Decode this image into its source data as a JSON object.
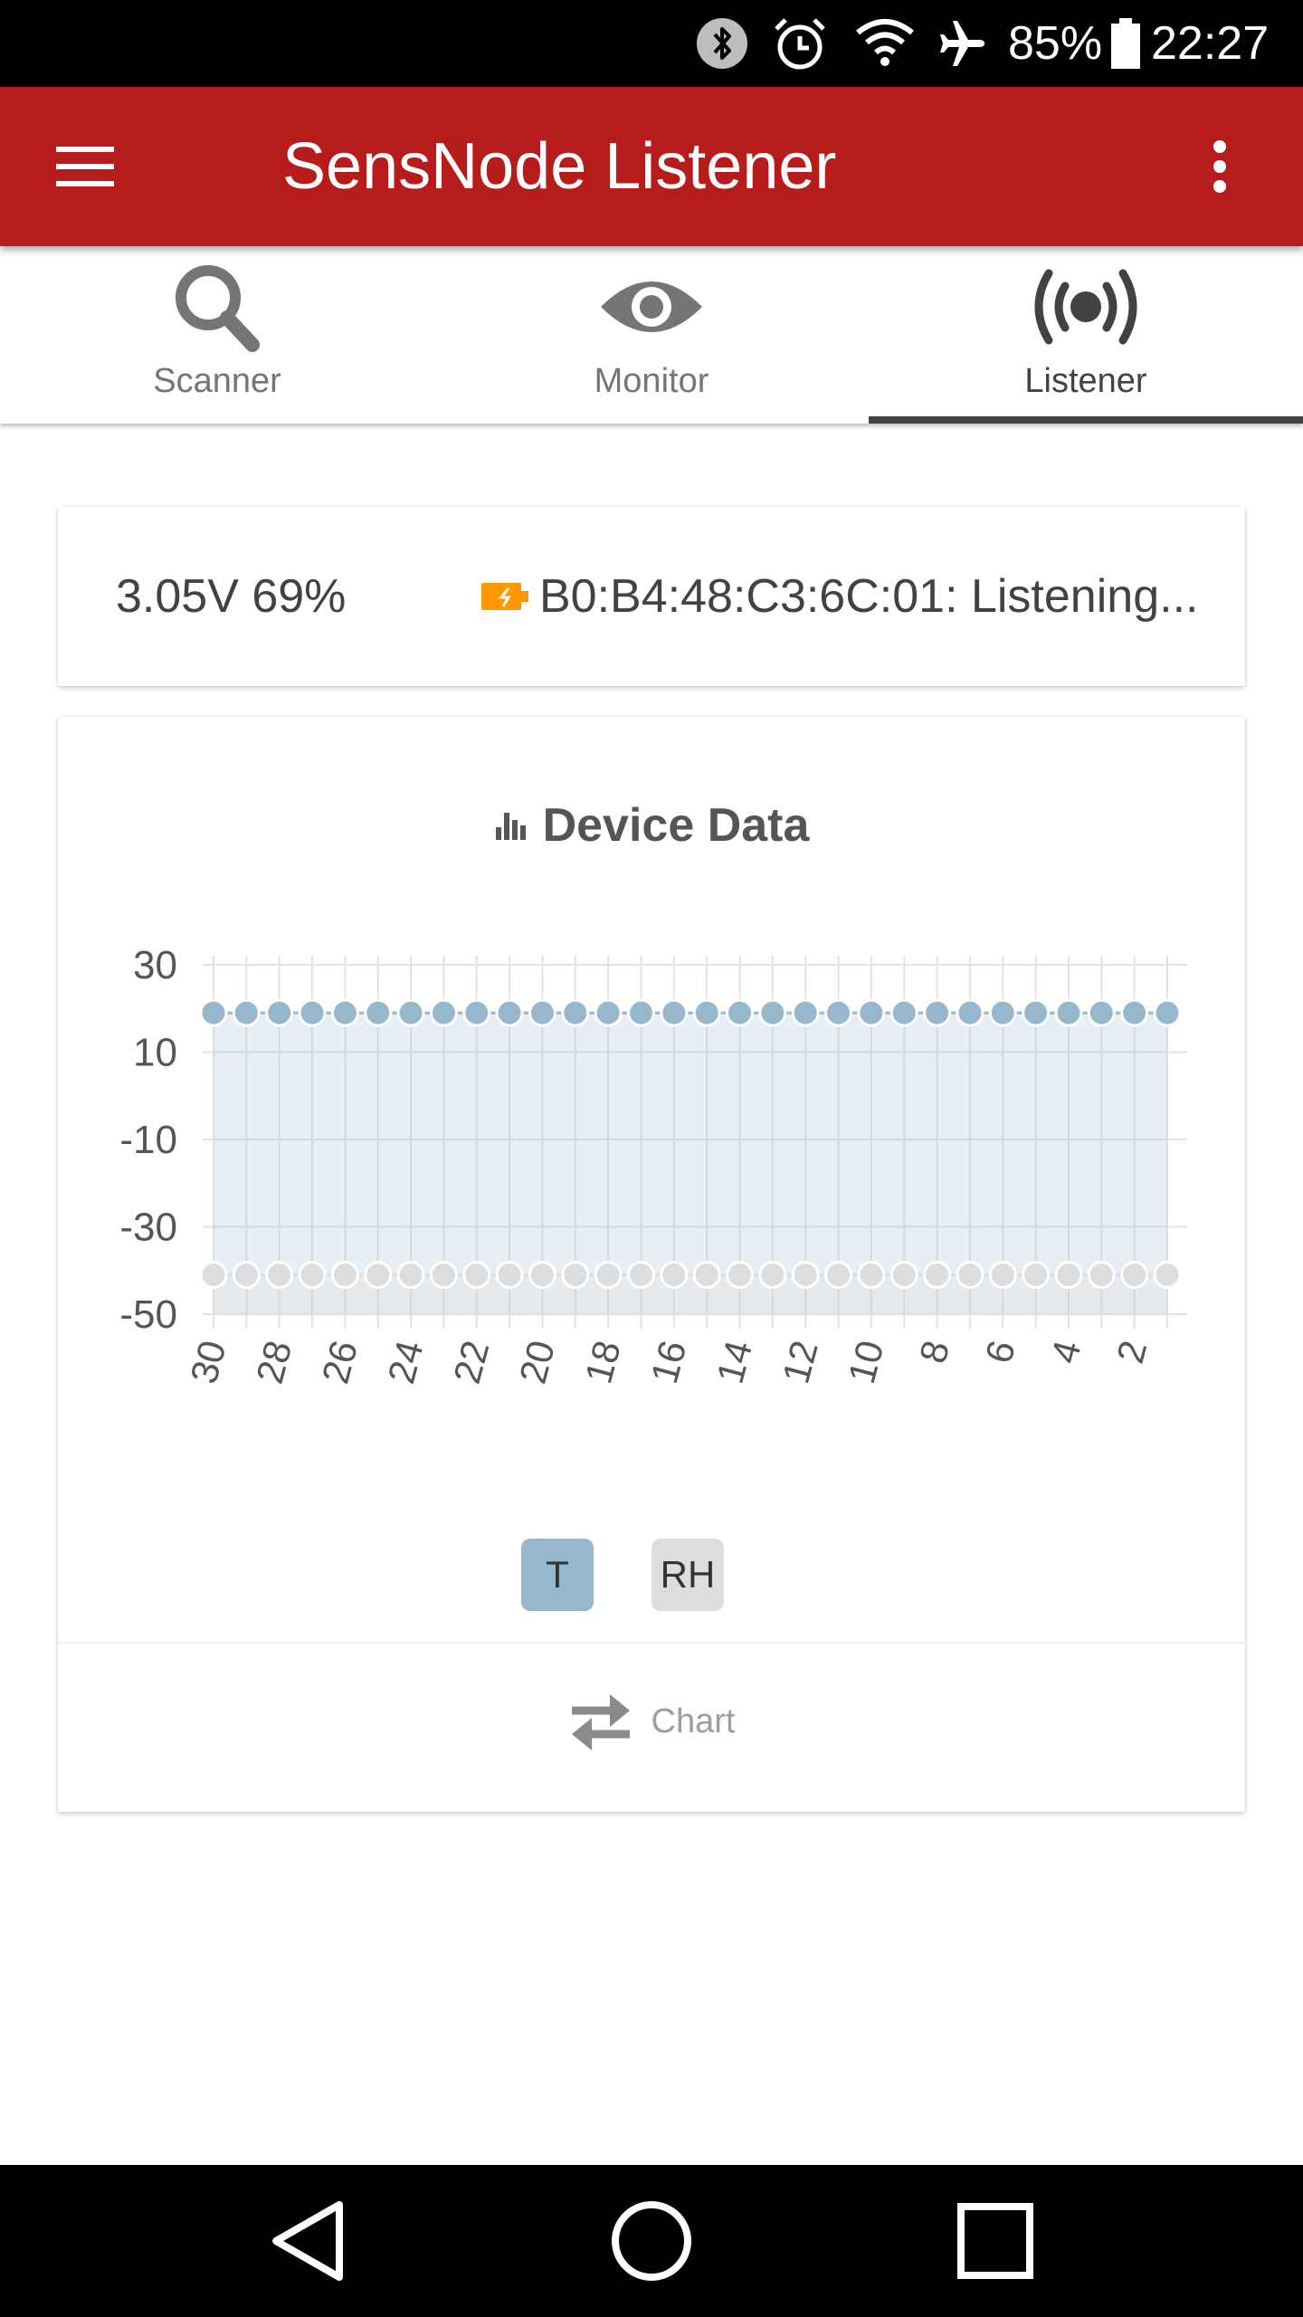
{
  "status_bar": {
    "battery_percent": "85%",
    "time": "22:27",
    "icons": [
      "bluetooth-icon",
      "alarm-icon",
      "wifi-icon",
      "airplane-icon",
      "battery-icon"
    ]
  },
  "app_bar": {
    "title": "SensNode Listener",
    "icons": [
      "menu-icon",
      "overflow-icon"
    ]
  },
  "tabs": [
    {
      "label": "Scanner",
      "icon": "search-icon",
      "active": false
    },
    {
      "label": "Monitor",
      "icon": "eye-icon",
      "active": false
    },
    {
      "label": "Listener",
      "icon": "broadcast-icon",
      "active": true
    }
  ],
  "device_status": {
    "voltage": "3.05V 69%",
    "status": "B0:B4:48:C3:6C:01: Listening...",
    "battery_icon_color": "#ff9800"
  },
  "device_data": {
    "title": "Device Data",
    "title_icon": "bar-chart-icon",
    "toggles": [
      "T",
      "RH"
    ],
    "switch_label": "Chart",
    "switch_icon": "swap-arrows-icon"
  },
  "colors": {
    "app_bar": "#b71c1c",
    "series_t": "#97b8cc",
    "series_rh": "#dddddd"
  },
  "chart_data": {
    "type": "line",
    "x": [
      30,
      29,
      28,
      27,
      26,
      25,
      24,
      23,
      22,
      21,
      20,
      19,
      18,
      17,
      16,
      15,
      14,
      13,
      12,
      11,
      10,
      9,
      8,
      7,
      6,
      5,
      4,
      3,
      2,
      1
    ],
    "x_tick_labels": [
      "30",
      "28",
      "26",
      "24",
      "22",
      "20",
      "18",
      "16",
      "14",
      "12",
      "10",
      "8",
      "6",
      "4",
      "2"
    ],
    "y_tick_labels": [
      "30",
      "10",
      "-10",
      "-30",
      "-50"
    ],
    "ylim": [
      -50,
      30
    ],
    "grid": true,
    "series": [
      {
        "name": "T",
        "values": [
          19,
          19,
          19,
          19,
          19,
          19,
          19,
          19,
          19,
          19,
          19,
          19,
          19,
          19,
          19,
          19,
          19,
          19,
          19,
          19,
          19,
          19,
          19,
          19,
          19,
          19,
          19,
          19,
          19,
          19
        ]
      },
      {
        "name": "RH",
        "values": [
          -41,
          -41,
          -41,
          -41,
          -41,
          -41,
          -41,
          -41,
          -41,
          -41,
          -41,
          -41,
          -41,
          -41,
          -41,
          -41,
          -41,
          -41,
          -41,
          -41,
          -41,
          -41,
          -41,
          -41,
          -41,
          -41,
          -41,
          -41,
          -41,
          -41
        ]
      }
    ]
  }
}
